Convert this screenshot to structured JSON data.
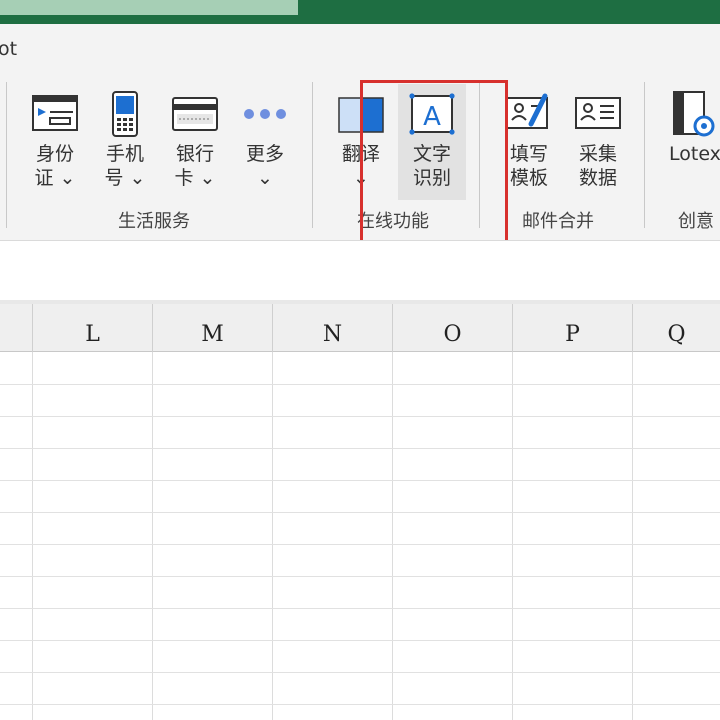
{
  "app": {
    "tab_label": "ot"
  },
  "ribbon": {
    "groups": [
      {
        "label": "生活服务",
        "buttons": [
          {
            "line1": "身份",
            "line2": "证 ⌄",
            "icon": "id-card-icon"
          },
          {
            "line1": "手机",
            "line2": "号 ⌄",
            "icon": "mobile-phone-icon"
          },
          {
            "line1": "银行",
            "line2": "卡 ⌄",
            "icon": "bank-card-icon"
          },
          {
            "line1": "更多",
            "line2": "⌄",
            "icon": "more-dots-icon"
          }
        ]
      },
      {
        "label": "在线功能",
        "buttons": [
          {
            "line1": "翻译",
            "line2": "⌄",
            "icon": "translate-icon"
          },
          {
            "line1": "文字",
            "line2": "识别",
            "icon": "text-recognition-icon"
          }
        ]
      },
      {
        "label": "邮件合并",
        "buttons": [
          {
            "line1": "填写",
            "line2": "模板",
            "icon": "fill-template-icon"
          },
          {
            "line1": "采集",
            "line2": "数据",
            "icon": "collect-data-icon"
          }
        ]
      },
      {
        "label": "创意",
        "buttons": [
          {
            "line1": "Lotex",
            "line2": "",
            "icon": "lotex-gear-icon"
          }
        ]
      }
    ]
  },
  "sheet": {
    "columns": [
      "L",
      "M",
      "N",
      "O",
      "P",
      "Q"
    ]
  },
  "colors": {
    "title_bar": "#1e6e42",
    "highlight": "#d7302d",
    "icon_blue": "#1d6fd1"
  }
}
